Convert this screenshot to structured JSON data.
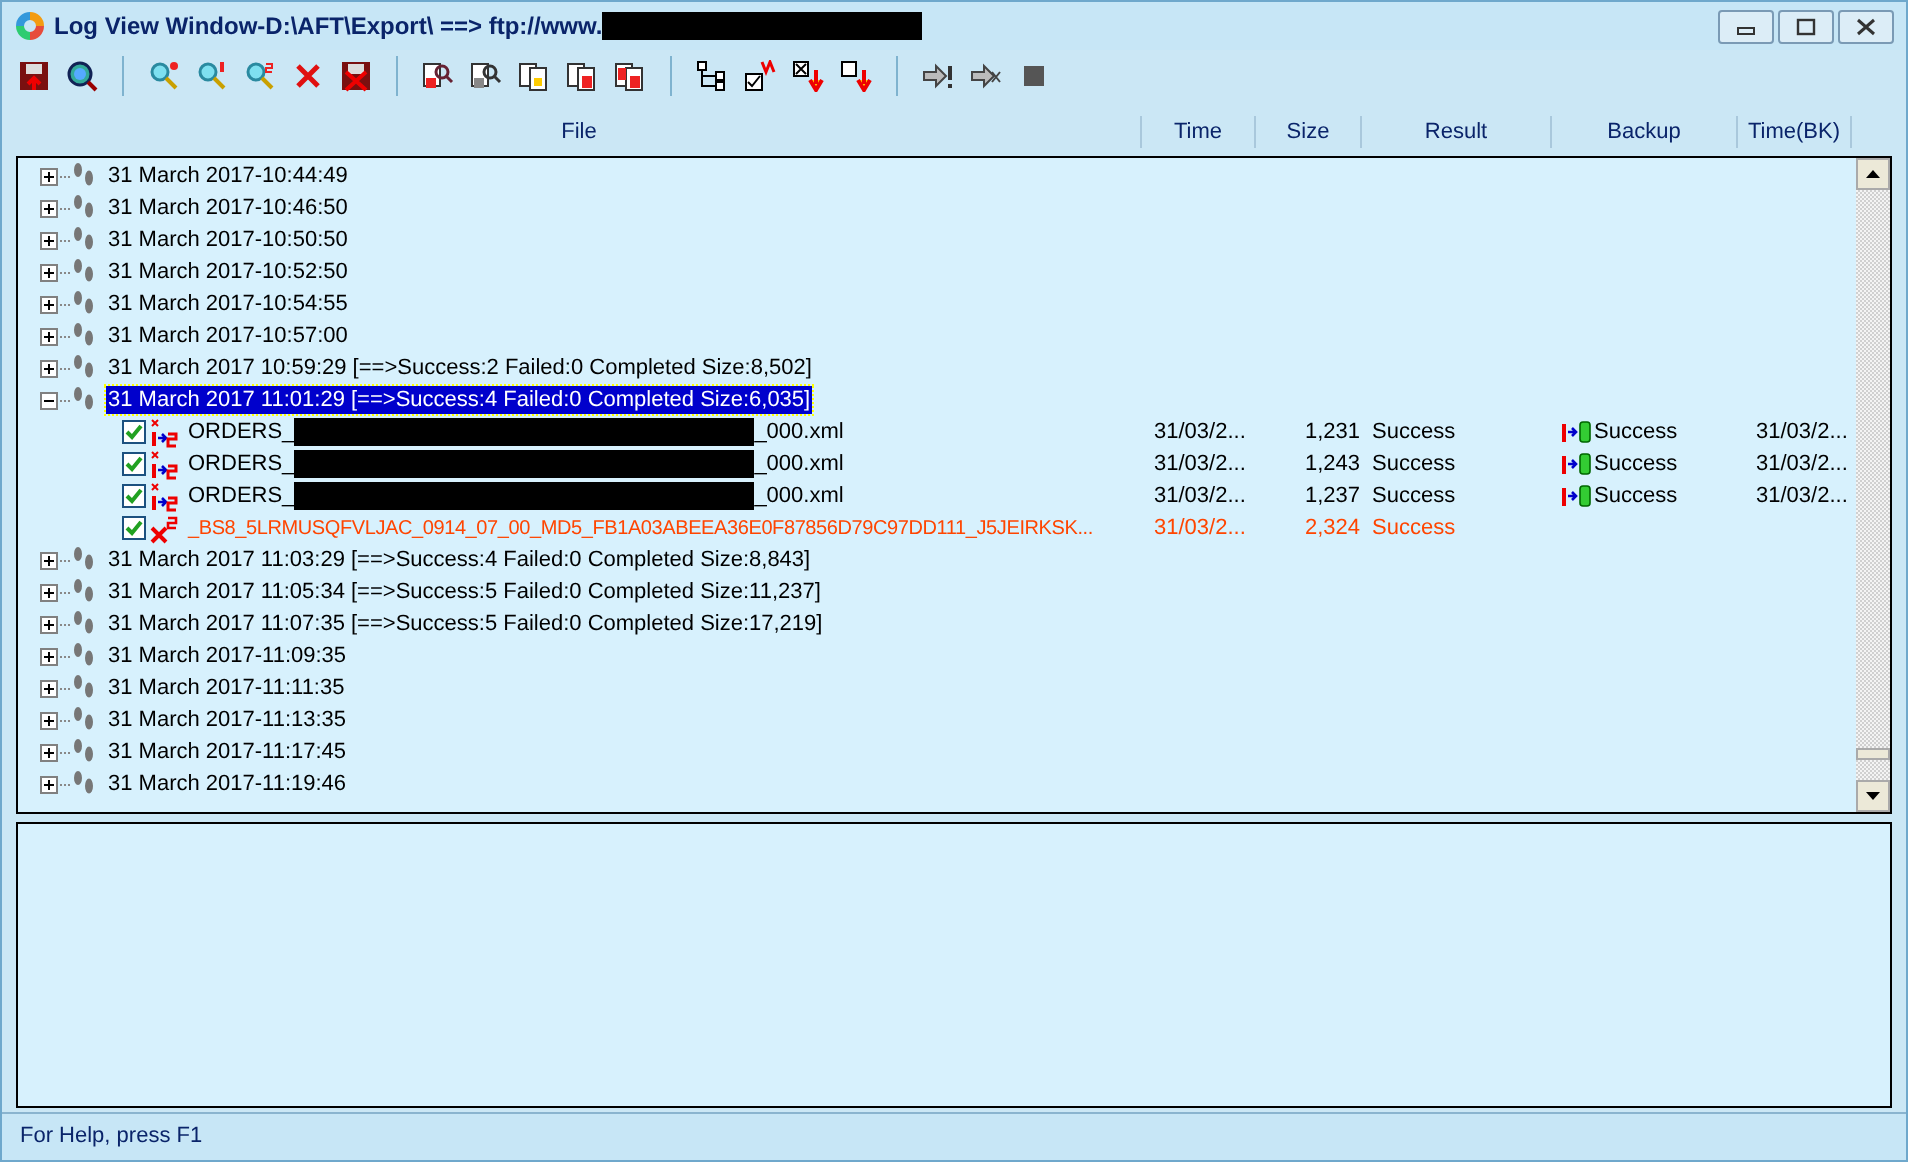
{
  "window": {
    "title": "Log View Window-D:\\AFT\\Export\\ ==> ftp://www.",
    "title_redacted": true
  },
  "columns": [
    "File",
    "Time",
    "Size",
    "Result",
    "Backup",
    "Time(BK)"
  ],
  "sessions": [
    {
      "label": "31 March 2017-10:44:49",
      "expanded": false,
      "selected": false
    },
    {
      "label": "31 March 2017-10:46:50",
      "expanded": false,
      "selected": false
    },
    {
      "label": "31 March 2017-10:50:50",
      "expanded": false,
      "selected": false
    },
    {
      "label": "31 March 2017-10:52:50",
      "expanded": false,
      "selected": false
    },
    {
      "label": "31 March 2017-10:54:55",
      "expanded": false,
      "selected": false
    },
    {
      "label": "31 March 2017-10:57:00",
      "expanded": false,
      "selected": false
    },
    {
      "label": "31 March 2017 10:59:29 [==>Success:2 Failed:0 Completed Size:8,502]",
      "expanded": false,
      "selected": false
    },
    {
      "label": "31 March 2017 11:01:29 [==>Success:4 Failed:0 Completed Size:6,035]",
      "expanded": true,
      "selected": true,
      "children": [
        {
          "kind": "ok",
          "checked": true,
          "name_start": "ORDERS_",
          "redacted": true,
          "name_end": "_000.xml",
          "time": "31/03/2...",
          "size": "1,231",
          "result": "Success",
          "backup": "Success",
          "time_bk": "31/03/2..."
        },
        {
          "kind": "ok",
          "checked": true,
          "name_start": "ORDERS_",
          "redacted": true,
          "name_end": "_000.xml",
          "time": "31/03/2...",
          "size": "1,243",
          "result": "Success",
          "backup": "Success",
          "time_bk": "31/03/2..."
        },
        {
          "kind": "ok",
          "checked": true,
          "name_start": "ORDERS_",
          "redacted": true,
          "name_end": "_000.xml",
          "time": "31/03/2...",
          "size": "1,237",
          "result": "Success",
          "backup": "Success",
          "time_bk": "31/03/2..."
        },
        {
          "kind": "error",
          "checked": true,
          "name_start": "_BS8_5LRMUSQFVLJAC_0914_07_00_MD5_FB1A03ABEEA36E0F87856D79C97DD111_J5JEIRKSK...",
          "redacted": false,
          "time": "31/03/2...",
          "size": "2,324",
          "result": "Success"
        }
      ]
    },
    {
      "label": "31 March 2017 11:03:29 [==>Success:4 Failed:0 Completed Size:8,843]",
      "expanded": false,
      "selected": false
    },
    {
      "label": "31 March 2017 11:05:34 [==>Success:5 Failed:0 Completed Size:11,237]",
      "expanded": false,
      "selected": false
    },
    {
      "label": "31 March 2017 11:07:35 [==>Success:5 Failed:0 Completed Size:17,219]",
      "expanded": false,
      "selected": false
    },
    {
      "label": "31 March 2017-11:09:35",
      "expanded": false,
      "selected": false
    },
    {
      "label": "31 March 2017-11:11:35",
      "expanded": false,
      "selected": false
    },
    {
      "label": "31 March 2017-11:13:35",
      "expanded": false,
      "selected": false
    },
    {
      "label": "31 March 2017-11:17:45",
      "expanded": false,
      "selected": false
    },
    {
      "label": "31 March 2017-11:19:46",
      "expanded": false,
      "selected": false
    }
  ],
  "status_bar": "For Help, press F1"
}
